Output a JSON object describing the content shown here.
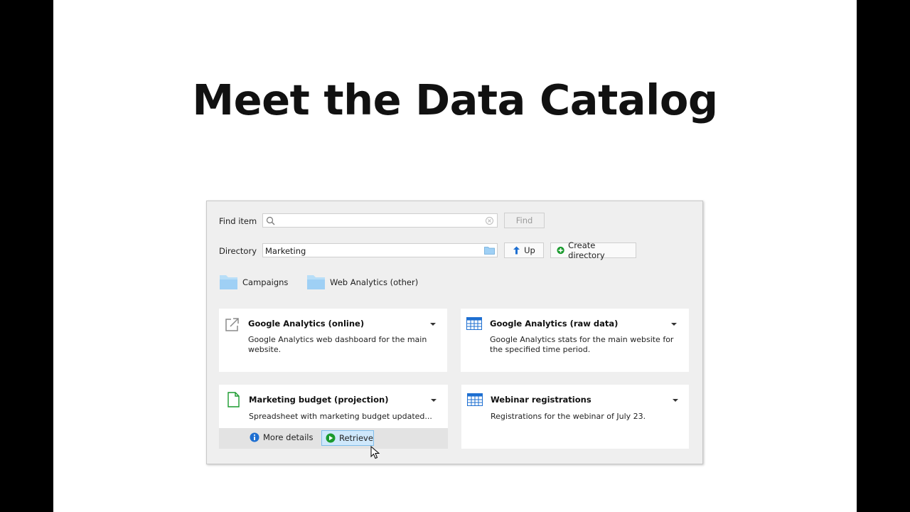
{
  "slide": {
    "title": "Meet the Data Catalog"
  },
  "search": {
    "label": "Find item",
    "value": "",
    "find_button": "Find"
  },
  "directory": {
    "label": "Directory",
    "value": "Marketing",
    "up_button": "Up",
    "create_button": "Create directory"
  },
  "folders": [
    {
      "name": "Campaigns"
    },
    {
      "name": "Web Analytics (other)"
    }
  ],
  "cards": [
    {
      "title": "Google Analytics (online)",
      "description_line1": "Google Analytics web dashboard for the main",
      "description_line2": "website.",
      "icon": "external-link-icon"
    },
    {
      "title": "Google Analytics (raw data)",
      "description_line1": "Google Analytics stats for the main website for",
      "description_line2": "the specified time period.",
      "icon": "table-icon"
    },
    {
      "title": "Marketing budget (projection)",
      "description_line1": "Spreadsheet with marketing budget updated...",
      "icon": "document-icon",
      "more_details": "More details",
      "retrieve": "Retrieve"
    },
    {
      "title": "Webinar registrations",
      "description_line1": "Registrations for the webinar of July 23.",
      "icon": "table-icon"
    }
  ],
  "colors": {
    "accent_blue": "#1e6fd1",
    "folder_blue": "#9fd0f5",
    "green": "#1a9a2e",
    "retrieve_bg": "#cfe8fb"
  }
}
